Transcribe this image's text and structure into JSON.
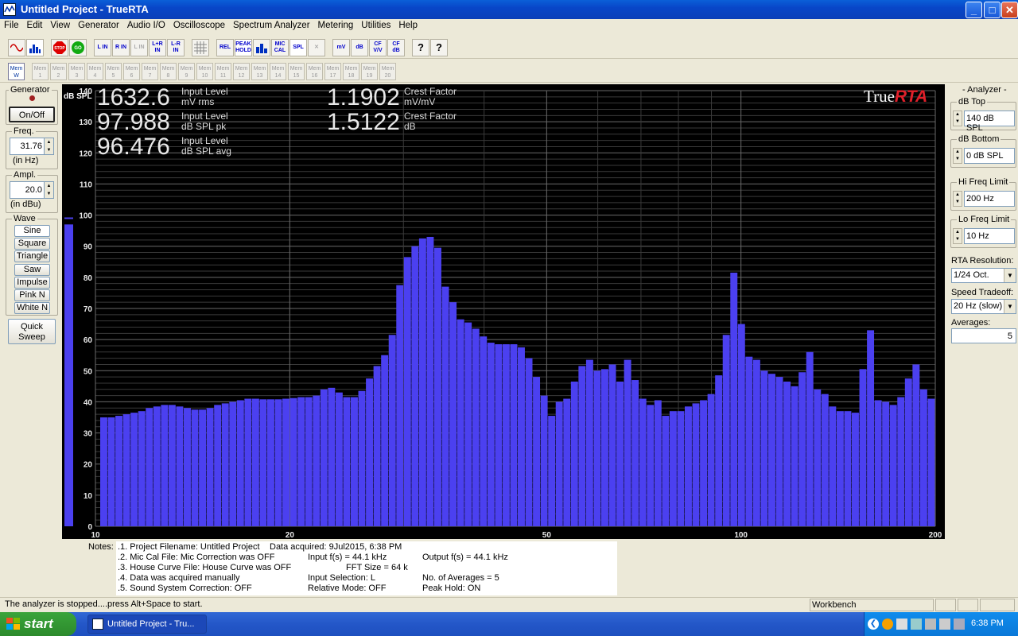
{
  "window": {
    "title": "Untitled Project - TrueRTA"
  },
  "menu": [
    "File",
    "Edit",
    "View",
    "Generator",
    "Audio I/O",
    "Oscilloscope",
    "Spectrum Analyzer",
    "Metering",
    "Utilities",
    "Help"
  ],
  "toolbar": {
    "l_in": "L IN",
    "r_in": "R IN",
    "l_in2": "L IN",
    "lr_in": "L+R IN",
    "lmr_in": "L-R IN",
    "rel": "REL",
    "peak_hold": "PEAK HOLD",
    "mic_cal": "MIC CAL",
    "spl": "SPL",
    "mv": "mV",
    "db": "dB",
    "cf_vv": "CF V/V",
    "cf_db": "CF dB",
    "help": "?",
    "context_help": "?"
  },
  "memory": {
    "first": "Mem W",
    "slots": [
      "Mem 1",
      "Mem 2",
      "Mem 3",
      "Mem 4",
      "Mem 5",
      "Mem 6",
      "Mem 7",
      "Mem 8",
      "Mem 9",
      "Mem 10",
      "Mem 11",
      "Mem 12",
      "Mem 13",
      "Mem 14",
      "Mem 15",
      "Mem 16",
      "Mem 17",
      "Mem 18",
      "Mem 19",
      "Mem 20"
    ]
  },
  "generator": {
    "label": "Generator",
    "on_off": "On/Off",
    "freq_label": "Freq.",
    "freq": "31.76",
    "freq_unit": "(in Hz)",
    "ampl_label": "Ampl.",
    "ampl": "20.0",
    "ampl_unit": "(in dBu)",
    "wave_label": "Wave",
    "waves": [
      "Sine",
      "Square",
      "Triangle",
      "Saw",
      "Impulse",
      "Pink N",
      "White N"
    ],
    "quick_sweep": "Quick Sweep"
  },
  "readouts": {
    "r1": {
      "value": "1632.6",
      "label1": "Input Level",
      "label2": "mV rms"
    },
    "r2": {
      "value": "97.988",
      "label1": "Input Level",
      "label2": "dB SPL pk"
    },
    "r3": {
      "value": "96.476",
      "label1": "Input Level",
      "label2": "dB SPL avg"
    },
    "r4": {
      "value": "1.1902",
      "label1": "Crest Factor",
      "label2": "mV/mV"
    },
    "r5": {
      "value": "1.5122",
      "label1": "Crest Factor",
      "label2": "dB"
    }
  },
  "logo": {
    "a": "True",
    "b": "RTA"
  },
  "analyzer": {
    "label": "Analyzer",
    "db_top_label": "dB Top",
    "db_top": "140 dB SPL",
    "db_bottom_label": "dB Bottom",
    "db_bottom": "0 dB SPL",
    "hi_label": "Hi Freq Limit",
    "hi": "200 Hz",
    "lo_label": "Lo Freq Limit",
    "lo": "10 Hz",
    "res_label": "RTA Resolution:",
    "res": "1/24 Oct.",
    "speed_label": "Speed Tradeoff:",
    "speed": "20 Hz (slow)",
    "avg_label": "Averages:",
    "avg": "5"
  },
  "notes": {
    "label": "Notes:",
    "n1": ".1. Project Filename: Untitled Project",
    "n1b": "Data acquired: 9Jul2015, 6:38 PM",
    "n2": ".2. Mic Cal File: Mic Correction was OFF",
    "n2b": "Input f(s) = 44.1 kHz",
    "n2c": "Output f(s) = 44.1 kHz",
    "n3": ".3. House Curve File: House Curve was OFF",
    "n3b": "FFT Size = 64 k",
    "n4": ".4. Data was acquired manually",
    "n4b": "Input Selection: L",
    "n4c": "No. of Averages = 5",
    "n5": ".5. Sound System Correction: OFF",
    "n5b": "Relative Mode:  OFF",
    "n5c": "Peak Hold: ON"
  },
  "status": {
    "text": "The analyzer is stopped....press Alt+Space to start.",
    "mode": "Workbench"
  },
  "taskbar": {
    "start": "start",
    "task": "Untitled Project - Tru...",
    "clock": "6:38 PM"
  },
  "colors": {
    "bar": "#4b40f0",
    "plot_bg": "#000000",
    "grid": "#3a3a3a",
    "major_grid": "#6a6a6a",
    "text": "#e8e8e8",
    "logo_red": "#e0202a"
  },
  "chart_data": {
    "type": "bar",
    "ylabel": "dB SPL",
    "ylim": [
      0,
      140
    ],
    "yticks": [
      0,
      10,
      20,
      30,
      40,
      50,
      60,
      70,
      80,
      90,
      100,
      110,
      120,
      130,
      140
    ],
    "xscale": "log",
    "xlim": [
      10,
      200
    ],
    "xticks": [
      10,
      20,
      50,
      100,
      200
    ],
    "level_meter": 97,
    "values": [
      35,
      35,
      35.5,
      36,
      36.5,
      37,
      38,
      38.5,
      39,
      39,
      38.5,
      38,
      37.5,
      37.5,
      38,
      39,
      39.5,
      40,
      40.5,
      41,
      41,
      40.8,
      40.8,
      40.8,
      41,
      41.2,
      41.5,
      41.5,
      42,
      44,
      44.5,
      43,
      41.5,
      41.5,
      43.5,
      47.5,
      51.5,
      55,
      61.5,
      77.5,
      86.5,
      90,
      92.5,
      93,
      89.5,
      77,
      72,
      66.5,
      65.5,
      63.5,
      61,
      59,
      58.5,
      58.5,
      58.5,
      57.5,
      54,
      48,
      42,
      35.5,
      40,
      41,
      46.5,
      51.5,
      53.5,
      50,
      50.5,
      52,
      46.5,
      53.5,
      47,
      41,
      39,
      40.5,
      35.5,
      37,
      37,
      38.5,
      39.5,
      40.5,
      42.5,
      48.5,
      61.5,
      81.5,
      65,
      54.5,
      53.5,
      50,
      49,
      48,
      46.5,
      45,
      49.5,
      56,
      44,
      42.5,
      38.5,
      37,
      37,
      36.5,
      50.5,
      63,
      40.5,
      40,
      39,
      41.5,
      47.5,
      52,
      44,
      41
    ]
  }
}
